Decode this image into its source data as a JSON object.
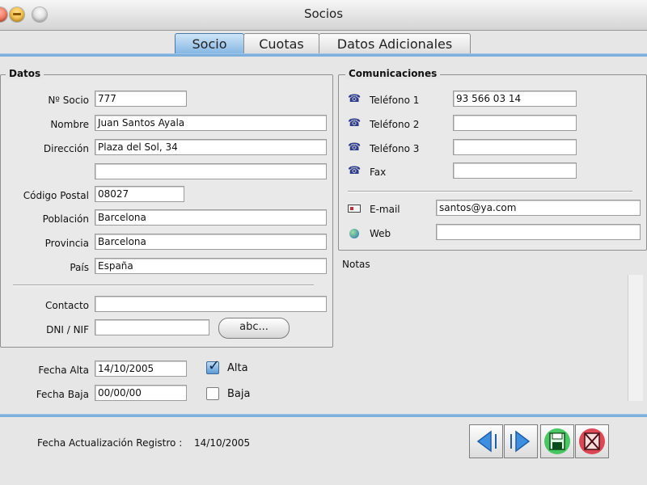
{
  "window": {
    "title": "Socios"
  },
  "tabs": [
    {
      "label": "Socio",
      "active": true
    },
    {
      "label": "Cuotas",
      "active": false
    },
    {
      "label": "Datos Adicionales",
      "active": false
    }
  ],
  "datos": {
    "legend": "Datos",
    "fields": {
      "socio_no": {
        "label": "Nº Socio",
        "value": "777"
      },
      "nombre": {
        "label": "Nombre",
        "value": "Juan Santos Ayala"
      },
      "direccion": {
        "label": "Dirección",
        "value": "Plaza del Sol, 34"
      },
      "direccion2": {
        "value": ""
      },
      "codigo_postal": {
        "label": "Código Postal",
        "value": "08027"
      },
      "poblacion": {
        "label": "Población",
        "value": "Barcelona"
      },
      "provincia": {
        "label": "Provincia",
        "value": "Barcelona"
      },
      "pais": {
        "label": "País",
        "value": "España"
      },
      "contacto": {
        "label": "Contacto",
        "value": ""
      },
      "dni": {
        "label": "DNI / NIF",
        "value": ""
      }
    },
    "abc_button": "abc..."
  },
  "fechas": {
    "alta": {
      "label": "Fecha Alta",
      "value": "14/10/2005",
      "checkbox_label": "Alta",
      "checked": true
    },
    "baja": {
      "label": "Fecha Baja",
      "value": "00/00/00",
      "checkbox_label": "Baja",
      "checked": false
    }
  },
  "comunicaciones": {
    "legend": "Comunicaciones",
    "telefono1": {
      "label": "Teléfono 1",
      "value": "93 566 03 14"
    },
    "telefono2": {
      "label": "Teléfono 2",
      "value": ""
    },
    "telefono3": {
      "label": "Teléfono 3",
      "value": ""
    },
    "fax": {
      "label": "Fax",
      "value": ""
    },
    "email": {
      "label": "E-mail",
      "value": "santos@ya.com"
    },
    "web": {
      "label": "Web",
      "value": ""
    }
  },
  "notas": {
    "label": "Notas",
    "value": ""
  },
  "footer": {
    "fecha_label": "Fecha Actualización Registro :",
    "fecha_value": "14/10/2005"
  },
  "icons": {
    "phone": "phone-icon",
    "email": "email-icon",
    "web": "globe-icon",
    "prev": "arrow-left-icon",
    "next": "arrow-right-icon",
    "save": "save-icon",
    "delete": "delete-icon"
  },
  "colors": {
    "accent": "#7fb0dd",
    "tab_active": "#7fb4e3",
    "save_green": "#2bbf4a",
    "delete_red": "#d82a3a",
    "arrow_blue": "#3f8fe0"
  }
}
